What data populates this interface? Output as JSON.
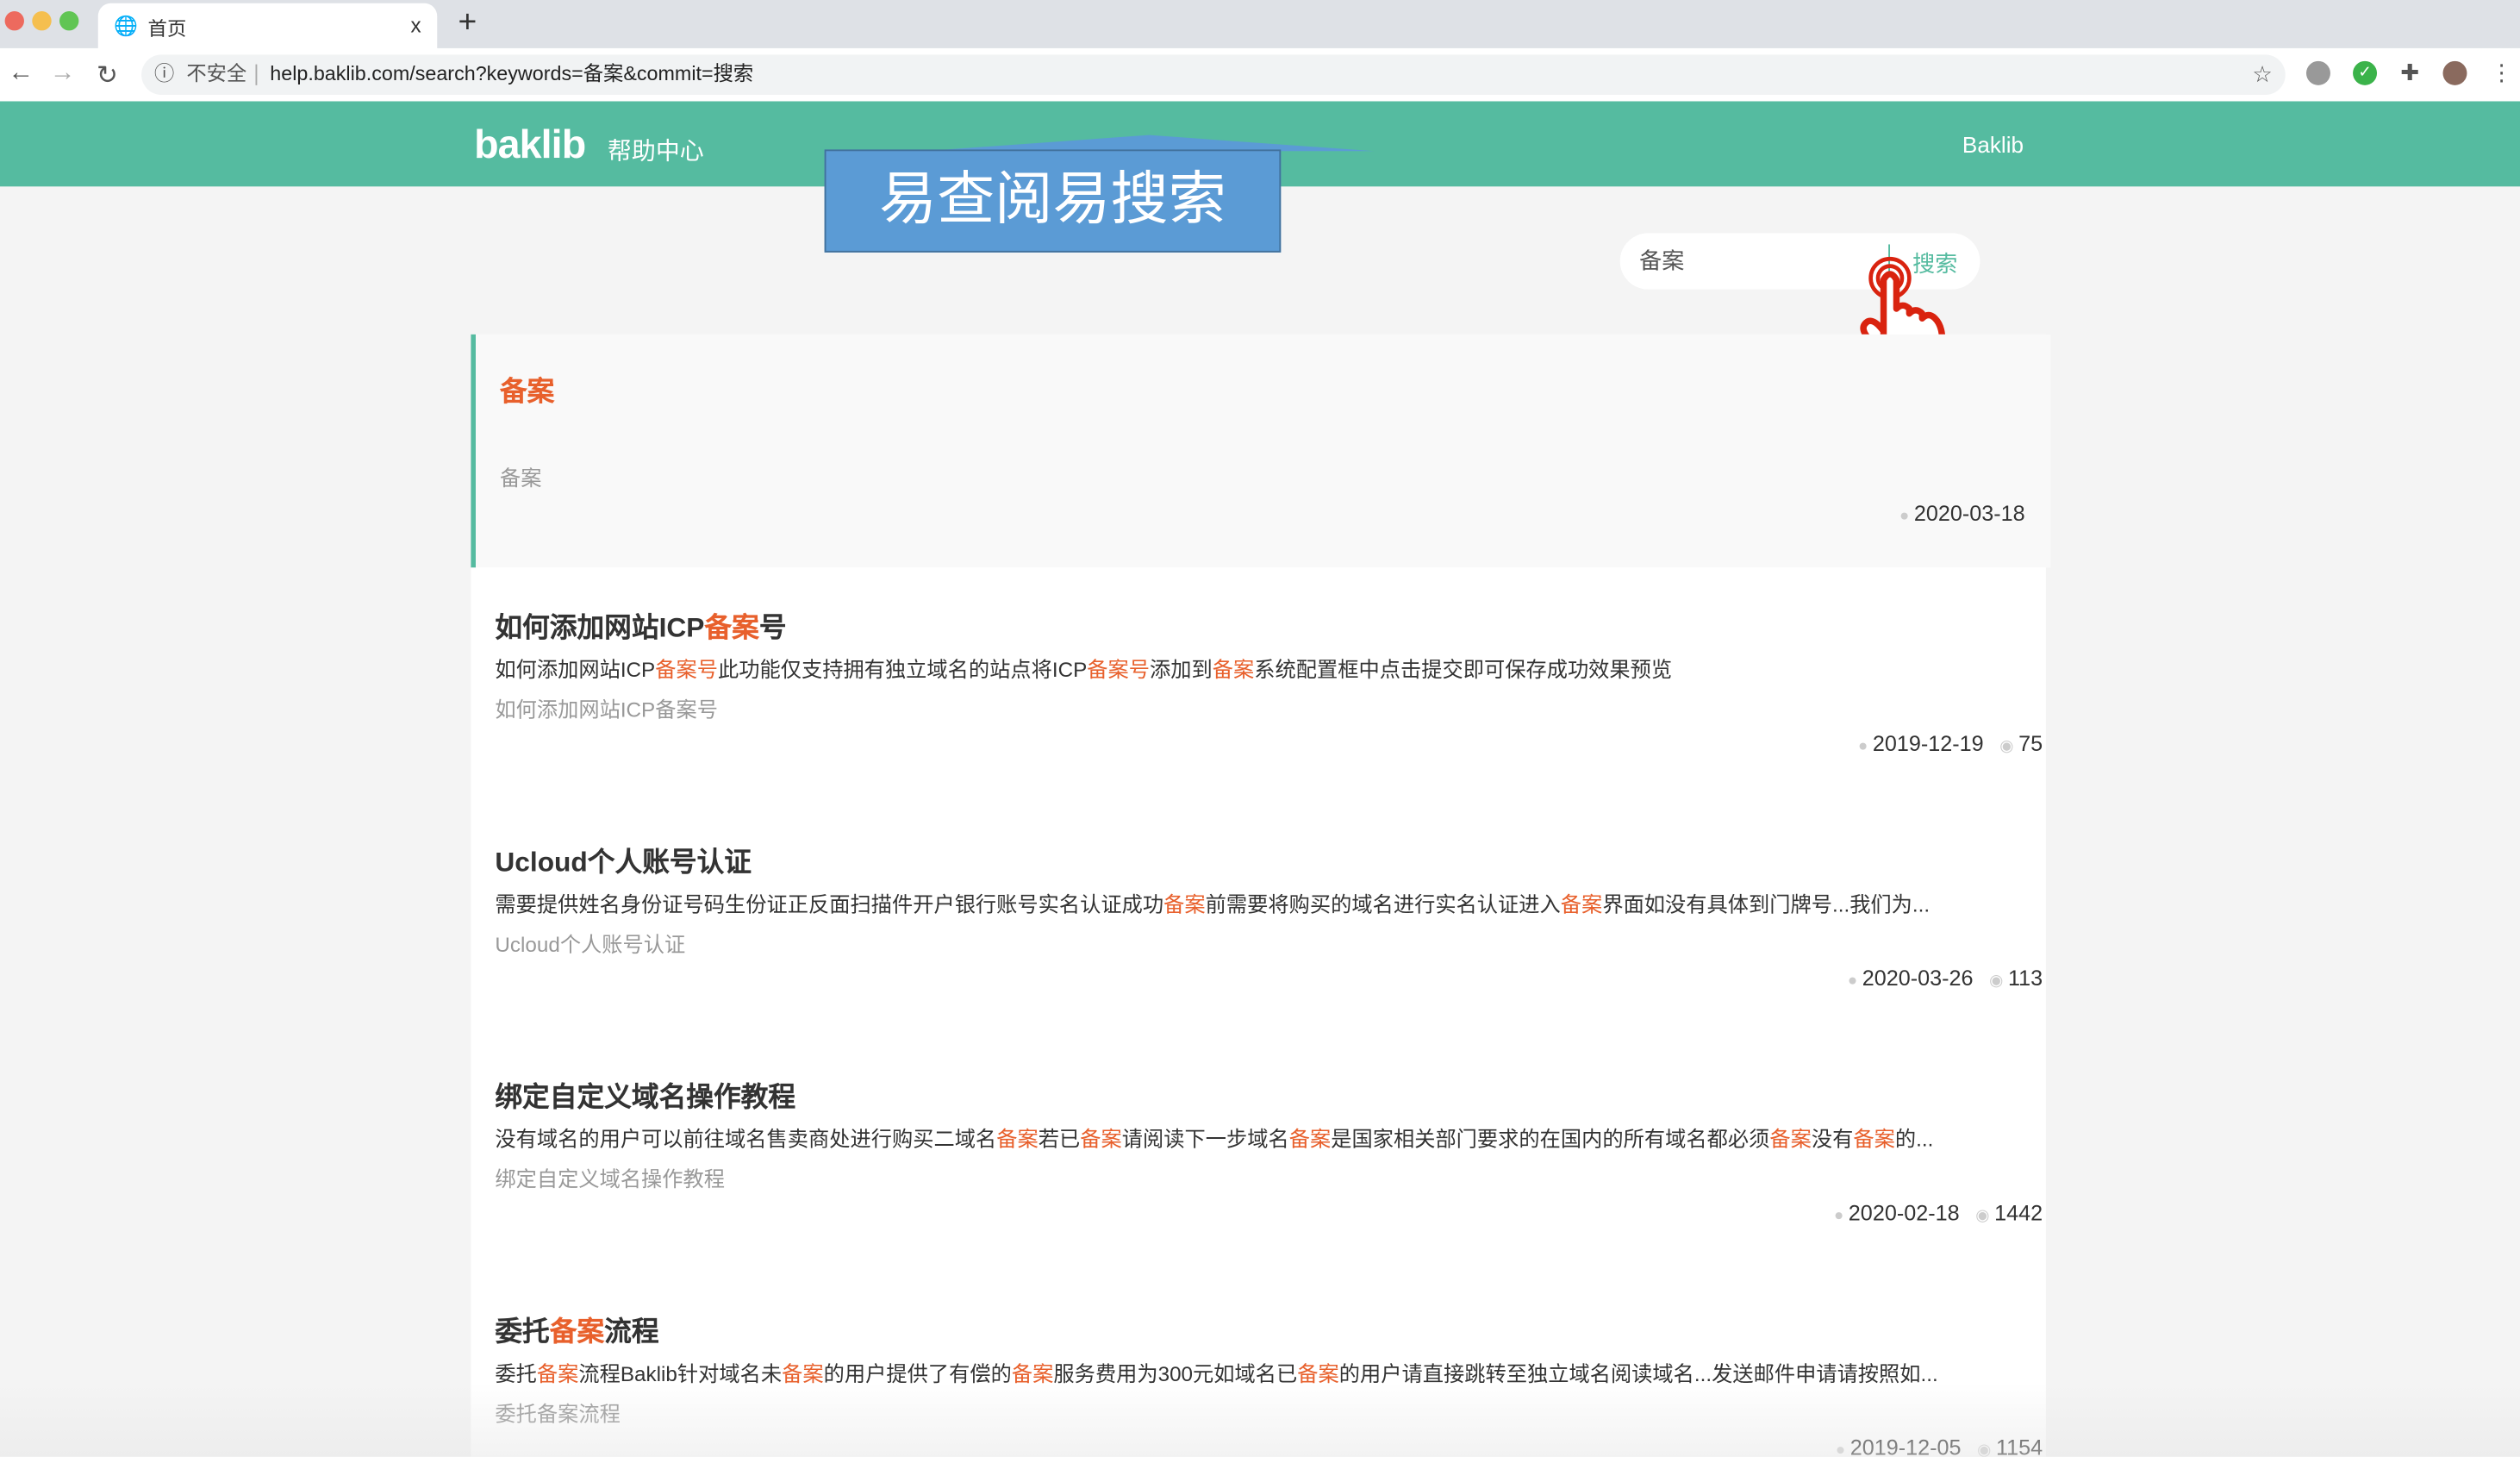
{
  "browser": {
    "tab_title": "首页",
    "tab_close": "x",
    "new_tab": "+",
    "security_label": "不安全",
    "url": "help.baklib.com/search?keywords=备案&commit=搜索",
    "icons": [
      "back-arrow-icon",
      "forward-arrow-icon",
      "reload-icon",
      "info-icon",
      "star-icon",
      "extension-icon",
      "profile-avatar"
    ]
  },
  "header": {
    "logo": "baklib",
    "logo_sub": "帮助中心",
    "nav_link": "Baklib",
    "color": "#55bba0"
  },
  "overlay": {
    "banner_text": "易查阅易搜索",
    "color": "#5b9bd5"
  },
  "search": {
    "value": "备案",
    "button": "搜索"
  },
  "results": [
    {
      "title": [
        {
          "t": "备案",
          "h": true
        }
      ],
      "snippet": [],
      "subtitle": "备案",
      "date": "2020-03-18",
      "views": null
    },
    {
      "title": [
        {
          "t": "如何添加网站ICP"
        },
        {
          "t": "备案",
          "h": true
        },
        {
          "t": "号"
        }
      ],
      "snippet": [
        {
          "t": "如何添加网站ICP"
        },
        {
          "t": "备案号",
          "h": true
        },
        {
          "t": "此功能仅支持拥有独立域名的站点将ICP"
        },
        {
          "t": "备案号",
          "h": true
        },
        {
          "t": "添加到"
        },
        {
          "t": "备案",
          "h": true
        },
        {
          "t": "系统配置框中点击提交即可保存成功效果预览"
        }
      ],
      "subtitle": "如何添加网站ICP备案号",
      "date": "2019-12-19",
      "views": "75"
    },
    {
      "title": [
        {
          "t": "Ucloud个人账号认证"
        }
      ],
      "snippet": [
        {
          "t": "需要提供姓名身份证号码生份证正反面扫描件开户银行账号实名认证成功"
        },
        {
          "t": "备案",
          "h": true
        },
        {
          "t": "前需要将购买的域名进行实名认证进入"
        },
        {
          "t": "备案",
          "h": true
        },
        {
          "t": "界面如没有具体到门牌号...我们为..."
        }
      ],
      "subtitle": "Ucloud个人账号认证",
      "date": "2020-03-26",
      "views": "113"
    },
    {
      "title": [
        {
          "t": "绑定自定义域名操作教程"
        }
      ],
      "snippet": [
        {
          "t": "没有域名的用户可以前往域名售卖商处进行购买二域名"
        },
        {
          "t": "备案",
          "h": true
        },
        {
          "t": "若已"
        },
        {
          "t": "备案",
          "h": true
        },
        {
          "t": "请阅读下一步域名"
        },
        {
          "t": "备案",
          "h": true
        },
        {
          "t": "是国家相关部门要求的在国内的所有域名都必须"
        },
        {
          "t": "备案",
          "h": true
        },
        {
          "t": "没有"
        },
        {
          "t": "备案",
          "h": true
        },
        {
          "t": "的..."
        }
      ],
      "subtitle": "绑定自定义域名操作教程",
      "date": "2020-02-18",
      "views": "1442"
    },
    {
      "title": [
        {
          "t": "委托"
        },
        {
          "t": "备案",
          "h": true
        },
        {
          "t": "流程"
        }
      ],
      "snippet": [
        {
          "t": "委托"
        },
        {
          "t": "备案",
          "h": true
        },
        {
          "t": "流程Baklib针对域名未"
        },
        {
          "t": "备案",
          "h": true
        },
        {
          "t": "的用户提供了有偿的"
        },
        {
          "t": "备案",
          "h": true
        },
        {
          "t": "服务费用为300元如域名已"
        },
        {
          "t": "备案",
          "h": true
        },
        {
          "t": "的用户请直接跳转至独立域名阅读域名...发送邮件申请请按照如..."
        }
      ],
      "subtitle": "委托备案流程",
      "date": "2019-12-05",
      "views": "1154"
    }
  ],
  "highlight_color": "#e8602c"
}
